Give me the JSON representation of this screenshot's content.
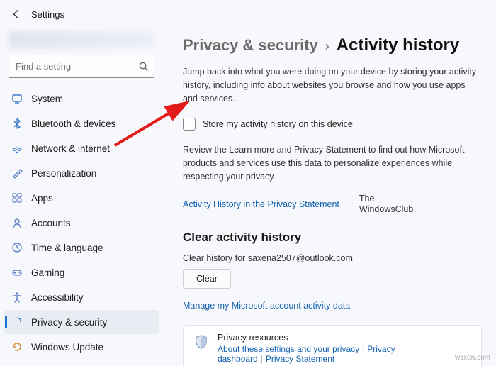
{
  "titlebar": {
    "title": "Settings"
  },
  "search": {
    "placeholder": "Find a setting"
  },
  "sidebar": {
    "items": [
      {
        "label": "System",
        "icon": "system",
        "selected": false
      },
      {
        "label": "Bluetooth & devices",
        "icon": "bluetooth",
        "selected": false
      },
      {
        "label": "Network & internet",
        "icon": "network",
        "selected": false
      },
      {
        "label": "Personalization",
        "icon": "personalization",
        "selected": false
      },
      {
        "label": "Apps",
        "icon": "apps",
        "selected": false
      },
      {
        "label": "Accounts",
        "icon": "accounts",
        "selected": false
      },
      {
        "label": "Time & language",
        "icon": "time",
        "selected": false
      },
      {
        "label": "Gaming",
        "icon": "gaming",
        "selected": false
      },
      {
        "label": "Accessibility",
        "icon": "accessibility",
        "selected": false
      },
      {
        "label": "Privacy & security",
        "icon": "privacy",
        "selected": true
      },
      {
        "label": "Windows Update",
        "icon": "update",
        "selected": false
      }
    ]
  },
  "breadcrumb": {
    "parent": "Privacy & security",
    "sep": "›",
    "current": "Activity history"
  },
  "body": {
    "desc": "Jump back into what you were doing on your device by storing your activity history, including info about websites you browse and how you use apps and services.",
    "checkbox_label": "Store my activity history on this device",
    "review": "Review the Learn more and Privacy Statement to find out how Microsoft products and services use this data to personalize experiences while respecting your privacy.",
    "link1": "Activity History in the Privacy Statement",
    "brand1": "The",
    "brand2": "WindowsClub",
    "section_h": "Clear activity history",
    "clear_line": "Clear history for saxena2507@outlook.com",
    "clear_btn": "Clear",
    "manage_link": "Manage my Microsoft account activity data",
    "resources": {
      "title": "Privacy resources",
      "links": [
        "About these settings and your privacy",
        "Privacy dashboard",
        "Privacy Statement"
      ]
    }
  },
  "watermark": "wsxdn.com",
  "icon_colors": {
    "system": "#3a78c8",
    "bluetooth": "#3a78c8",
    "network": "#3a78c8",
    "personalization": "#5d7fc7",
    "apps": "#5d7fc7",
    "accounts": "#5d7fc7",
    "time": "#5d7fc7",
    "gaming": "#5d7fc7",
    "accessibility": "#5d7fc7",
    "privacy": "#3a78c8",
    "update": "#d68a2a"
  }
}
